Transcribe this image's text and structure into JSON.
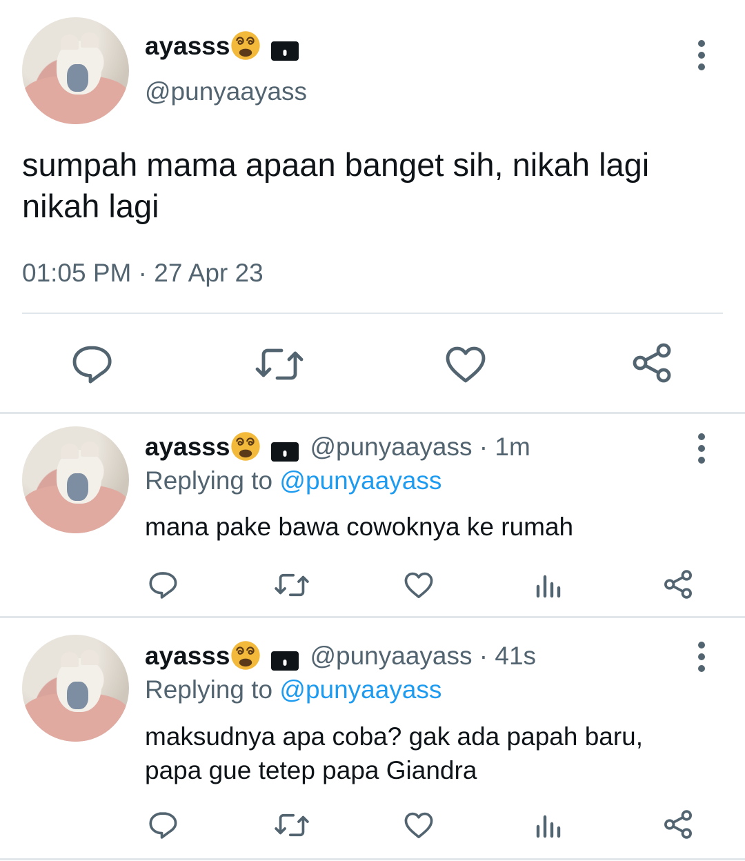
{
  "main_tweet": {
    "display_name": "ayasss",
    "handle": "@punyaayass",
    "text_line1": "sumpah mama apaan banget sih, nikah lagi",
    "text_line2": "nikah lagi",
    "timestamp": "01:05 PM · 27 Apr 23"
  },
  "replies": [
    {
      "display_name": "ayasss",
      "handle": "@punyaayass",
      "age": "· 1m",
      "replying_prefix": "Replying to ",
      "replying_handle": "@punyaayass",
      "text_line1": "mana pake bawa cowoknya ke rumah",
      "text_line2": ""
    },
    {
      "display_name": "ayasss",
      "handle": "@punyaayass",
      "age": "· 41s",
      "replying_prefix": "Replying to ",
      "replying_handle": "@punyaayass",
      "text_line1": "maksudnya apa coba? gak ada papah baru,",
      "text_line2": "papa gue tetep papa Giandra"
    }
  ],
  "icons": {
    "reply": "reply-icon",
    "retweet": "retweet-icon",
    "like": "like-icon",
    "views": "views-icon",
    "share": "share-icon",
    "more": "more-icon",
    "lock": "lock-icon",
    "emoji": "dizzy-face-emoji"
  },
  "colors": {
    "text": "#0f1419",
    "secondary": "#536471",
    "link": "#1d9bf0",
    "divider": "#e1e6ea",
    "emoji": "#f2b93b"
  }
}
